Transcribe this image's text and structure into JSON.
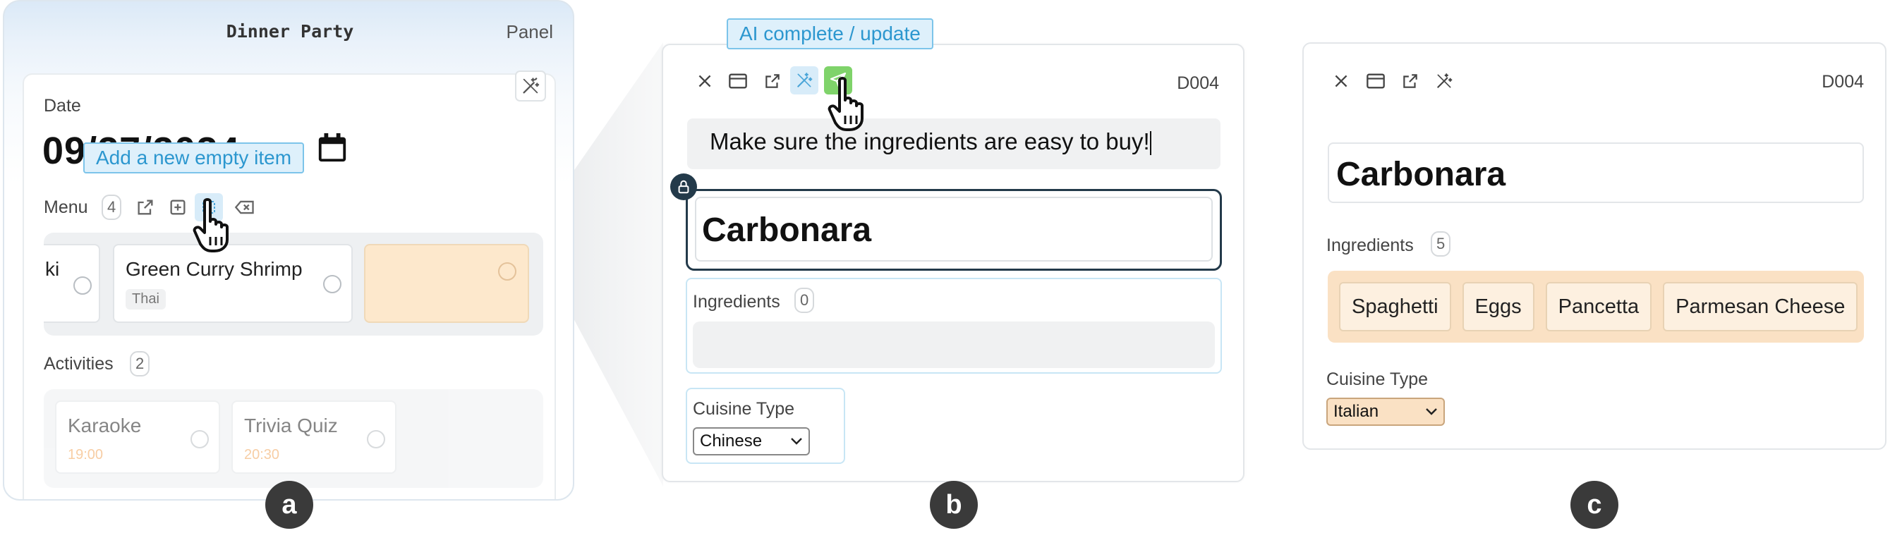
{
  "panel_a": {
    "title": "Dinner Party",
    "panel_link": "Panel",
    "date_label": "Date",
    "date_value": "09/27/2024",
    "tooltip": "Add a new empty item",
    "menu_label": "Menu",
    "menu_count": "4",
    "menu_items": [
      {
        "name": "ki",
        "tag": ""
      },
      {
        "name": "Green Curry Shrimp",
        "tag": "Thai"
      },
      {
        "name": "",
        "tag": ""
      }
    ],
    "activities_label": "Activities",
    "activities_count": "2",
    "activities": [
      {
        "name": "Karaoke",
        "time": "19:00"
      },
      {
        "name": "Trivia Quiz",
        "time": "20:30"
      }
    ]
  },
  "panel_b": {
    "tooltip": "AI complete / update",
    "doc_id": "D004",
    "prompt": "Make sure the ingredients are easy to buy!",
    "title": "Carbonara",
    "ingredients_label": "Ingredients",
    "ingredients_count": "0",
    "cuisine_label": "Cuisine Type",
    "cuisine_value": "Chinese"
  },
  "panel_c": {
    "doc_id": "D004",
    "title": "Carbonara",
    "ingredients_label": "Ingredients",
    "ingredients_count": "5",
    "ingredients": [
      "Spaghetti",
      "Eggs",
      "Pancetta",
      "Parmesan Cheese"
    ],
    "cuisine_label": "Cuisine Type",
    "cuisine_value": "Italian"
  },
  "labels": [
    "a",
    "b",
    "c"
  ],
  "colors": {
    "accent_blue": "#2c97cf",
    "tooltip_bg": "#def0fb",
    "new_item_orange": "#fde8cc",
    "send_green": "#7fd36a",
    "time_orange": "#f2a65a",
    "dark_navy": "#233a4a"
  }
}
